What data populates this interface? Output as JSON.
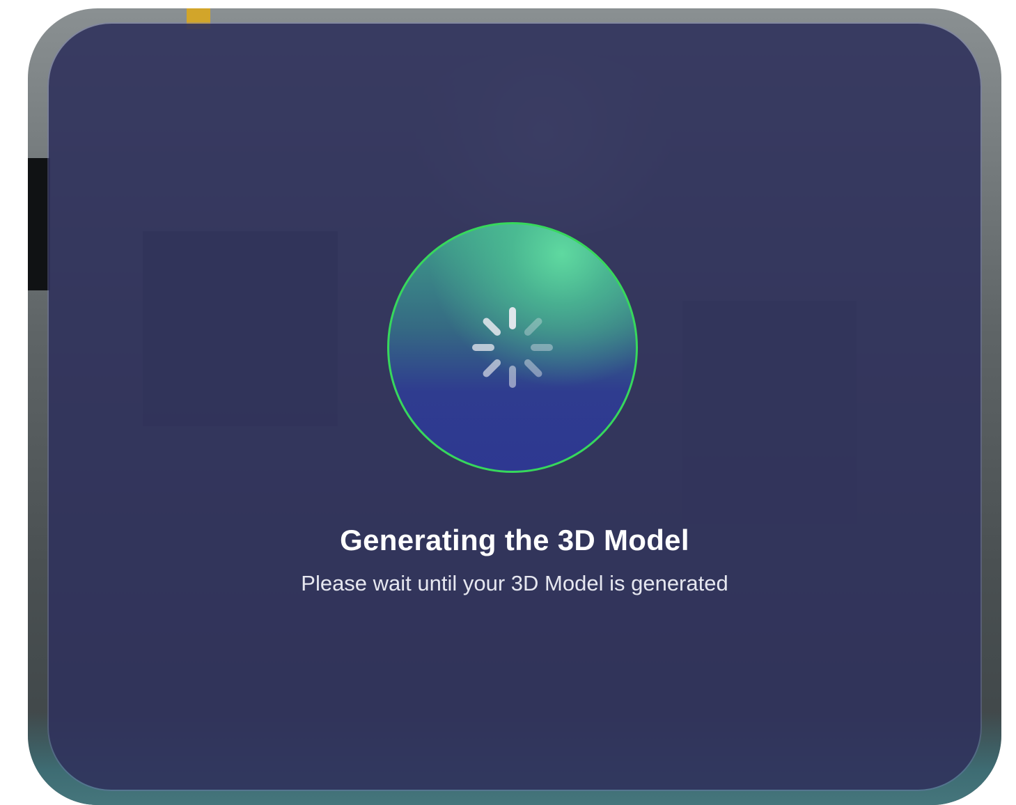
{
  "loading_dialog": {
    "title": "Generating the 3D Model",
    "subtitle": "Please wait until your 3D Model is generated",
    "spinner_icon": "activity-spinner-icon"
  },
  "colors": {
    "overlay": "#30325C",
    "ring": "#37D85C",
    "circle_top": "#5FD9A0",
    "circle_bottom": "#2E3891",
    "text": "#FFFFFF"
  }
}
